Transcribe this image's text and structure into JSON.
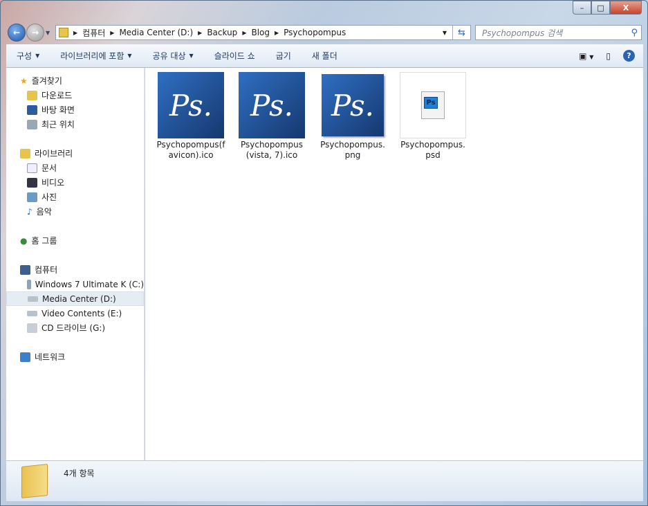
{
  "window": {
    "minimize": "–",
    "maximize": "□",
    "close": "X"
  },
  "address": {
    "crumbs": [
      "컴퓨터",
      "Media Center (D:)",
      "Backup",
      "Blog",
      "Psychopompus"
    ]
  },
  "search": {
    "placeholder": "Psychopompus 검색"
  },
  "toolbar": {
    "organize": "구성",
    "include_library": "라이브러리에 포함",
    "share": "공유 대상",
    "slideshow": "슬라이드 쇼",
    "burn": "굽기",
    "new_folder": "새 폴더"
  },
  "sidebar": {
    "favorites": {
      "label": "즐겨찾기",
      "items": [
        "다운로드",
        "바탕 화면",
        "최근 위치"
      ]
    },
    "libraries": {
      "label": "라이브러리",
      "items": [
        "문서",
        "비디오",
        "사진",
        "음악"
      ]
    },
    "homegroup": "홈 그룹",
    "computer": {
      "label": "컴퓨터",
      "items": [
        "Windows 7 Ultimate K (C:)",
        "Media Center (D:)",
        "Video Contents (E:)",
        "CD 드라이브 (G:)"
      ]
    },
    "network": "네트워크"
  },
  "files": [
    {
      "name": "Psychopompus(favicon).ico",
      "thumb": "Ps."
    },
    {
      "name": "Psychopompus(vista, 7).ico",
      "thumb": "Ps."
    },
    {
      "name": "Psychopompus.png",
      "thumb": "Ps."
    },
    {
      "name": "Psychopompus.psd",
      "thumb": "Ps"
    }
  ],
  "status": {
    "count": "4개 항목"
  }
}
